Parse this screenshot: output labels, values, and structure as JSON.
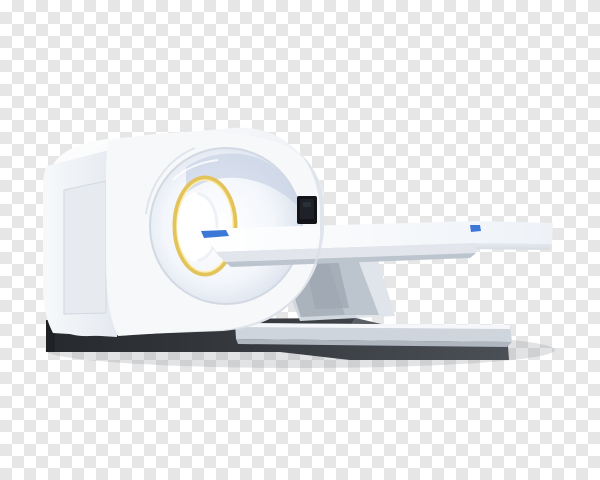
{
  "colors": {
    "checker_light": "#ffffff",
    "checker_dark": "#e6e6e6",
    "gantry_white": "#f2f3f5",
    "gantry_shadow": "#d9dde3",
    "inner_ring": "#d8dfec",
    "gold_ring": "#e0c460",
    "table_white": "#f7f8fa",
    "table_side": "#d5d9e0",
    "table_blue": "#3b78d8",
    "base_dark": "#2f3236",
    "base_mid": "#494d53",
    "screen_dark": "#121418"
  },
  "icons": {
    "scanner": "ct-scanner-icon"
  }
}
